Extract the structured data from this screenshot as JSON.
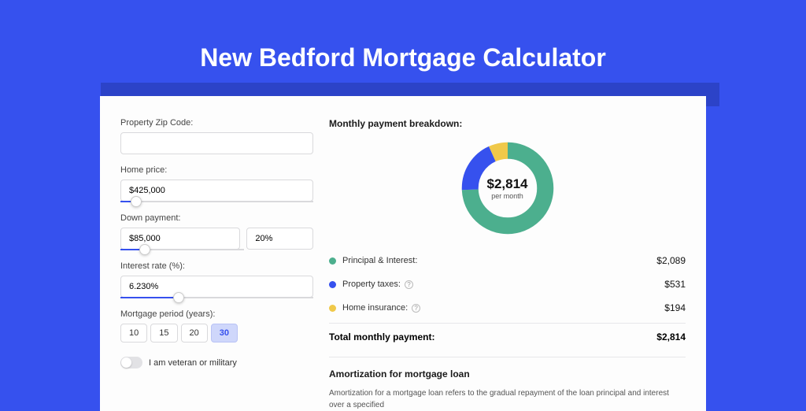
{
  "title": "New Bedford Mortgage Calculator",
  "form": {
    "zip_label": "Property Zip Code:",
    "zip_value": "",
    "homeprice_label": "Home price:",
    "homeprice_value": "$425,000",
    "homeprice_slider_pct": 8,
    "downpayment_label": "Down payment:",
    "downpayment_value": "$85,000",
    "downpayment_pct_value": "20%",
    "downpayment_slider_pct": 20,
    "interest_label": "Interest rate (%):",
    "interest_value": "6.230%",
    "interest_slider_pct": 30,
    "period_label": "Mortgage period (years):",
    "period_options": [
      "10",
      "15",
      "20",
      "30"
    ],
    "period_active_index": 3,
    "veteran_label": "I am veteran or military"
  },
  "breakdown": {
    "title": "Monthly payment breakdown:",
    "center_amount": "$2,814",
    "center_sub": "per month",
    "items": [
      {
        "label": "Principal & Interest:",
        "value": "$2,089",
        "color": "#4caf8e",
        "help": false
      },
      {
        "label": "Property taxes:",
        "value": "$531",
        "color": "#3651ee",
        "help": true
      },
      {
        "label": "Home insurance:",
        "value": "$194",
        "color": "#f0c94a",
        "help": true
      }
    ],
    "total_label": "Total monthly payment:",
    "total_value": "$2,814"
  },
  "amort": {
    "title": "Amortization for mortgage loan",
    "body": "Amortization for a mortgage loan refers to the gradual repayment of the loan principal and interest over a specified"
  },
  "colors": {
    "pi": "#4caf8e",
    "tax": "#3651ee",
    "ins": "#f0c94a"
  },
  "chart_data": {
    "type": "pie",
    "title": "Monthly payment breakdown:",
    "categories": [
      "Principal & Interest",
      "Property taxes",
      "Home insurance"
    ],
    "values": [
      2089,
      531,
      194
    ],
    "colors": [
      "#4caf8e",
      "#3651ee",
      "#f0c94a"
    ],
    "total": 2814,
    "annotations": [
      "$2,814",
      "per month"
    ]
  }
}
